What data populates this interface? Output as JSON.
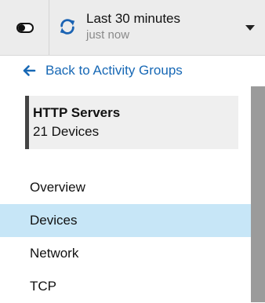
{
  "topbar": {
    "time_range": {
      "label": "Last 30 minutes",
      "sublabel": "just now"
    }
  },
  "back_link": {
    "label": "Back to Activity Groups"
  },
  "group": {
    "title": "HTTP Servers",
    "device_count_label": "21 Devices"
  },
  "nav": {
    "items": [
      {
        "label": "Overview",
        "active": false
      },
      {
        "label": "Devices",
        "active": true
      },
      {
        "label": "Network",
        "active": false
      },
      {
        "label": "TCP",
        "active": false
      }
    ]
  },
  "colors": {
    "link": "#1768b5",
    "refresh_icon": "#1b63b3",
    "active_item_bg": "#c7e6f7",
    "rail": "#9b9b9b"
  }
}
